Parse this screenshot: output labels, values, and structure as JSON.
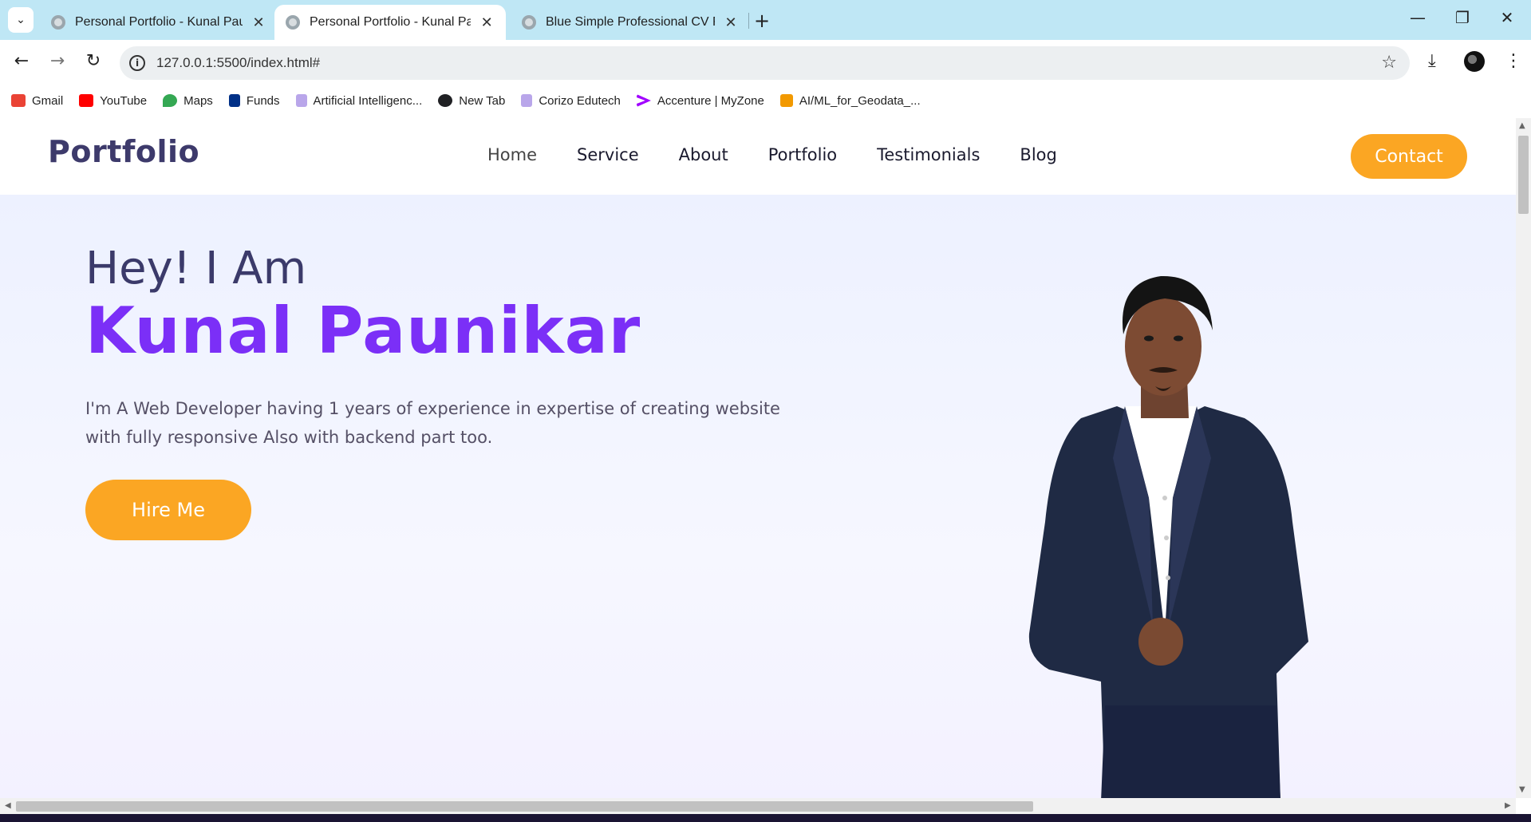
{
  "browser": {
    "tabs": [
      {
        "title": "Personal Portfolio - Kunal Paunikar",
        "active": false
      },
      {
        "title": "Personal Portfolio - Kunal Paunikar",
        "active": true
      },
      {
        "title": "Blue Simple Professional CV Resume",
        "active": false
      }
    ],
    "url": "127.0.0.1:5500/index.html#",
    "bookmarks": [
      {
        "label": "Gmail",
        "icon": "gmail-icon",
        "color": "#ea4335"
      },
      {
        "label": "YouTube",
        "icon": "youtube-icon",
        "color": "#ff0000"
      },
      {
        "label": "Maps",
        "icon": "maps-icon",
        "color": "#34a853"
      },
      {
        "label": "Funds",
        "icon": "paypal-icon",
        "color": "#003087"
      },
      {
        "label": "Artificial Intelligenc...",
        "icon": "bookmark-icon",
        "color": "#8a6fd1"
      },
      {
        "label": "New Tab",
        "icon": "globe-icon",
        "color": "#202124"
      },
      {
        "label": "Corizo Edutech",
        "icon": "bookmark-icon",
        "color": "#8a6fd1"
      },
      {
        "label": "Accenture | MyZone",
        "icon": "accenture-icon",
        "color": "#a100ff"
      },
      {
        "label": "AI/ML_for_Geodata_...",
        "icon": "bookmark-icon",
        "color": "#f29900"
      }
    ]
  },
  "site": {
    "logo": "Portfolio",
    "nav": [
      "Home",
      "Service",
      "About",
      "Portfolio",
      "Testimonials",
      "Blog"
    ],
    "contact_label": "Contact"
  },
  "hero": {
    "greeting": "Hey! I Am",
    "name": "Kunal Paunikar",
    "intro": "I'm A Web Developer having 1 years of experience in expertise of creating website with fully responsive Also with backend part too.",
    "hire_label": "Hire Me"
  },
  "colors": {
    "accent": "#fba623",
    "brand_purple": "#7b2ff7",
    "dark_navy": "#3b3a6a"
  }
}
